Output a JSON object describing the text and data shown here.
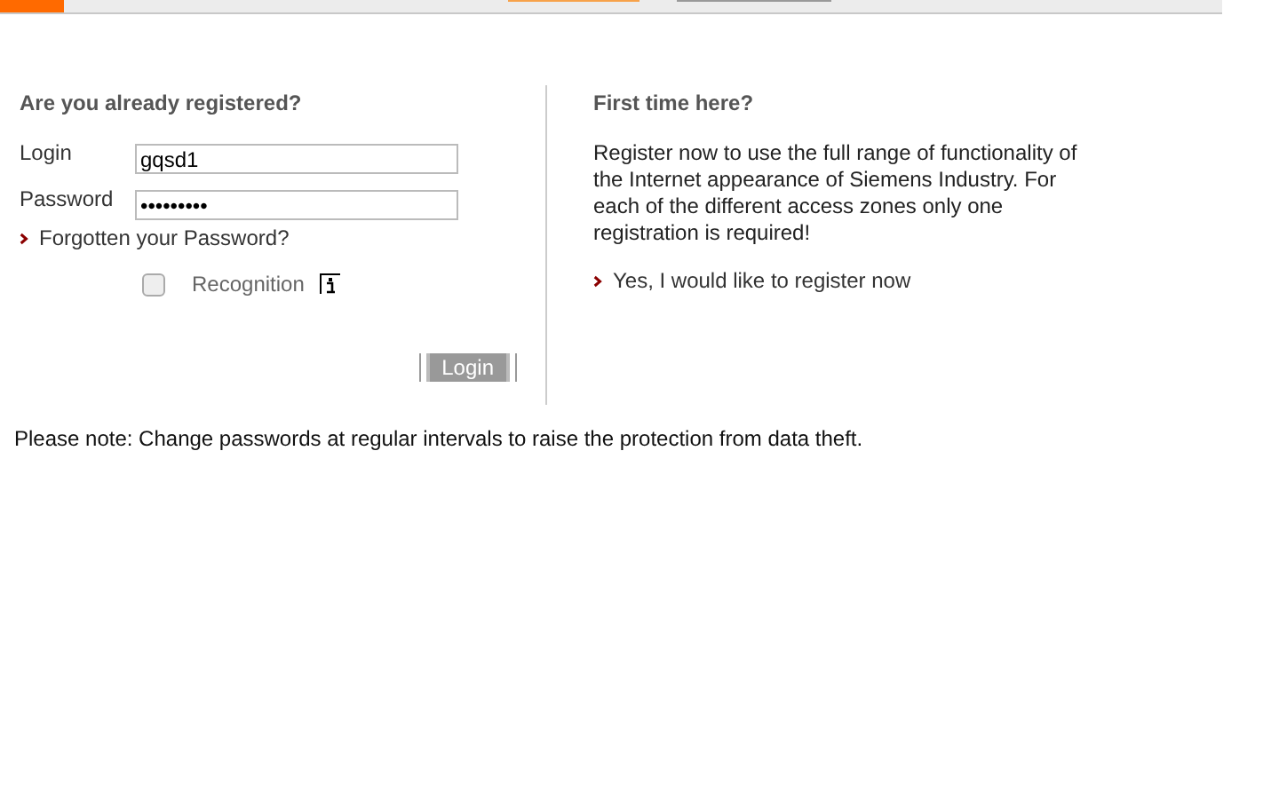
{
  "login_panel": {
    "heading": "Are you already registered?",
    "fields": [
      {
        "label": "Login",
        "value": "gqsd1"
      },
      {
        "label": "Password",
        "value": "•••••••••"
      }
    ],
    "forgot_link": "Forgotten your Password?",
    "recognition": {
      "label": "Recognition",
      "checked": false
    },
    "submit": "Login"
  },
  "register_panel": {
    "heading": "First time here?",
    "text": "Register now to use the full range of functionality of the Internet appearance of Siemens Industry. For each of the different access zones only one registration is required!",
    "link": "Yes, I would like to register now"
  },
  "note": "Please note: Change passwords at regular intervals to raise the protection from data theft."
}
